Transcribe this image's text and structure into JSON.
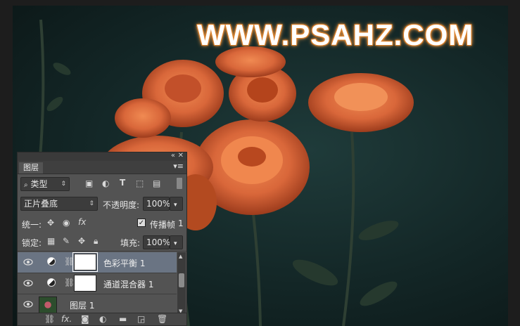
{
  "canvas": {
    "watermark": "WWW.PSAHZ.COM"
  },
  "colors": {
    "rose": "#d9673a",
    "rose_dark": "#8f3216",
    "panel_bg": "#535353",
    "selected_row": "#6a7483"
  },
  "panel": {
    "collapse_icon": "double-chevron-icon",
    "close_icon": "close-icon",
    "tab_label": "图层",
    "menu_icon": "panel-menu-icon",
    "filter_kind": "类型",
    "filter_icons": [
      "image-filter-icon",
      "adjustment-filter-icon",
      "type-filter-icon",
      "shape-filter-icon",
      "smart-object-filter-icon"
    ],
    "blend_mode": "正片叠底",
    "opacity_label": "不透明度:",
    "opacity_value": "100%",
    "unify_label": "统一:",
    "propagate_label": "传播帧",
    "propagate_value": "1",
    "lock_label": "锁定:",
    "fill_label": "填充:",
    "fill_value": "100%"
  },
  "layers": [
    {
      "name": "色彩平衡 1",
      "selected": true,
      "type": "adjustment"
    },
    {
      "name": "通道混合器 1",
      "selected": false,
      "type": "adjustment"
    },
    {
      "name": "图层 1",
      "selected": false,
      "type": "pixel"
    }
  ],
  "bottom_icons": [
    "link-layers-icon",
    "fx-icon",
    "add-mask-icon",
    "new-adjustment-icon",
    "new-group-icon",
    "new-layer-icon",
    "delete-icon"
  ]
}
